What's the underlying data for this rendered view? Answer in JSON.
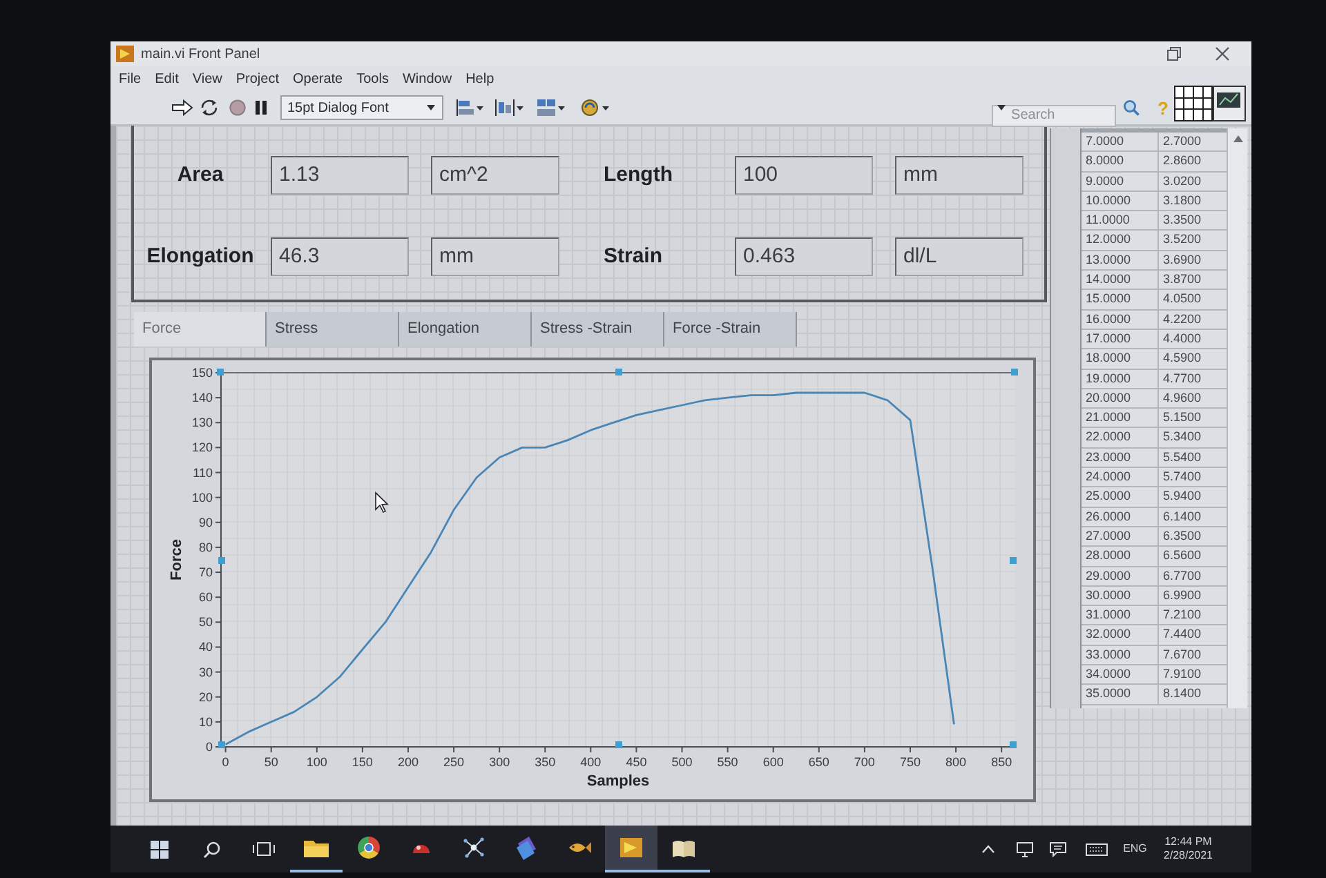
{
  "window": {
    "title": "main.vi Front Panel"
  },
  "menu": [
    "File",
    "Edit",
    "View",
    "Project",
    "Operate",
    "Tools",
    "Window",
    "Help"
  ],
  "toolbar": {
    "font": "15pt Dialog Font",
    "search": {
      "placeholder": "Search"
    },
    "help_label": "?"
  },
  "indicators": [
    {
      "label": "Area",
      "value": "1.13",
      "unit": "cm^2"
    },
    {
      "label": "Length",
      "value": "100",
      "unit": "mm"
    },
    {
      "label": "Elongation",
      "value": "46.3",
      "unit": "mm"
    },
    {
      "label": "Strain",
      "value": "0.463",
      "unit": "dl/L"
    }
  ],
  "tabs": [
    {
      "label": "Force",
      "selected": true
    },
    {
      "label": "Stress",
      "selected": false
    },
    {
      "label": "Elongation",
      "selected": false
    },
    {
      "label": "Stress -Strain",
      "selected": false
    },
    {
      "label": "Force -Strain",
      "selected": false
    }
  ],
  "graph": {
    "chart_data": {
      "type": "line",
      "xlabel": "Samples",
      "ylabel": "Force",
      "x": [
        0,
        25,
        50,
        75,
        100,
        125,
        150,
        175,
        200,
        225,
        250,
        275,
        300,
        325,
        350,
        375,
        400,
        425,
        450,
        475,
        500,
        525,
        550,
        575,
        600,
        625,
        650,
        675,
        700,
        725,
        750,
        775,
        798
      ],
      "values": [
        1,
        6,
        10,
        14,
        20,
        28,
        39,
        50,
        64,
        78,
        95,
        108,
        116,
        120,
        120,
        123,
        127,
        130,
        133,
        135,
        137,
        139,
        140,
        141,
        141,
        142,
        142,
        142,
        142,
        139,
        131,
        70,
        9
      ],
      "xlim": [
        -5,
        865
      ],
      "ylim": [
        0,
        150
      ],
      "xticks": [
        0,
        50,
        100,
        150,
        200,
        250,
        300,
        350,
        400,
        450,
        500,
        550,
        600,
        650,
        700,
        750,
        800,
        850
      ],
      "yticks": [
        0,
        10,
        20,
        30,
        40,
        50,
        60,
        70,
        80,
        90,
        100,
        110,
        120,
        130,
        140,
        150
      ],
      "grid": true
    }
  },
  "table": {
    "rows": [
      [
        "7.0000",
        "2.7000"
      ],
      [
        "8.0000",
        "2.8600"
      ],
      [
        "9.0000",
        "3.0200"
      ],
      [
        "10.0000",
        "3.1800"
      ],
      [
        "11.0000",
        "3.3500"
      ],
      [
        "12.0000",
        "3.5200"
      ],
      [
        "13.0000",
        "3.6900"
      ],
      [
        "14.0000",
        "3.8700"
      ],
      [
        "15.0000",
        "4.0500"
      ],
      [
        "16.0000",
        "4.2200"
      ],
      [
        "17.0000",
        "4.4000"
      ],
      [
        "18.0000",
        "4.5900"
      ],
      [
        "19.0000",
        "4.7700"
      ],
      [
        "20.0000",
        "4.9600"
      ],
      [
        "21.0000",
        "5.1500"
      ],
      [
        "22.0000",
        "5.3400"
      ],
      [
        "23.0000",
        "5.5400"
      ],
      [
        "24.0000",
        "5.7400"
      ],
      [
        "25.0000",
        "5.9400"
      ],
      [
        "26.0000",
        "6.1400"
      ],
      [
        "27.0000",
        "6.3500"
      ],
      [
        "28.0000",
        "6.5600"
      ],
      [
        "29.0000",
        "6.7700"
      ],
      [
        "30.0000",
        "6.9900"
      ],
      [
        "31.0000",
        "7.2100"
      ],
      [
        "32.0000",
        "7.4400"
      ],
      [
        "33.0000",
        "7.6700"
      ],
      [
        "34.0000",
        "7.9100"
      ],
      [
        "35.0000",
        "8.1400"
      ]
    ]
  },
  "taskbar": {
    "apps": [
      {
        "open": true,
        "selected": false
      },
      {
        "open": false,
        "selected": false
      },
      {
        "open": false,
        "selected": false
      },
      {
        "open": false,
        "selected": false
      },
      {
        "open": false,
        "selected": false
      },
      {
        "open": false,
        "selected": false
      },
      {
        "open": true,
        "selected": true
      },
      {
        "open": true,
        "selected": false
      }
    ],
    "language": "ENG",
    "time": "12:44 PM",
    "date": "2/28/2021"
  }
}
